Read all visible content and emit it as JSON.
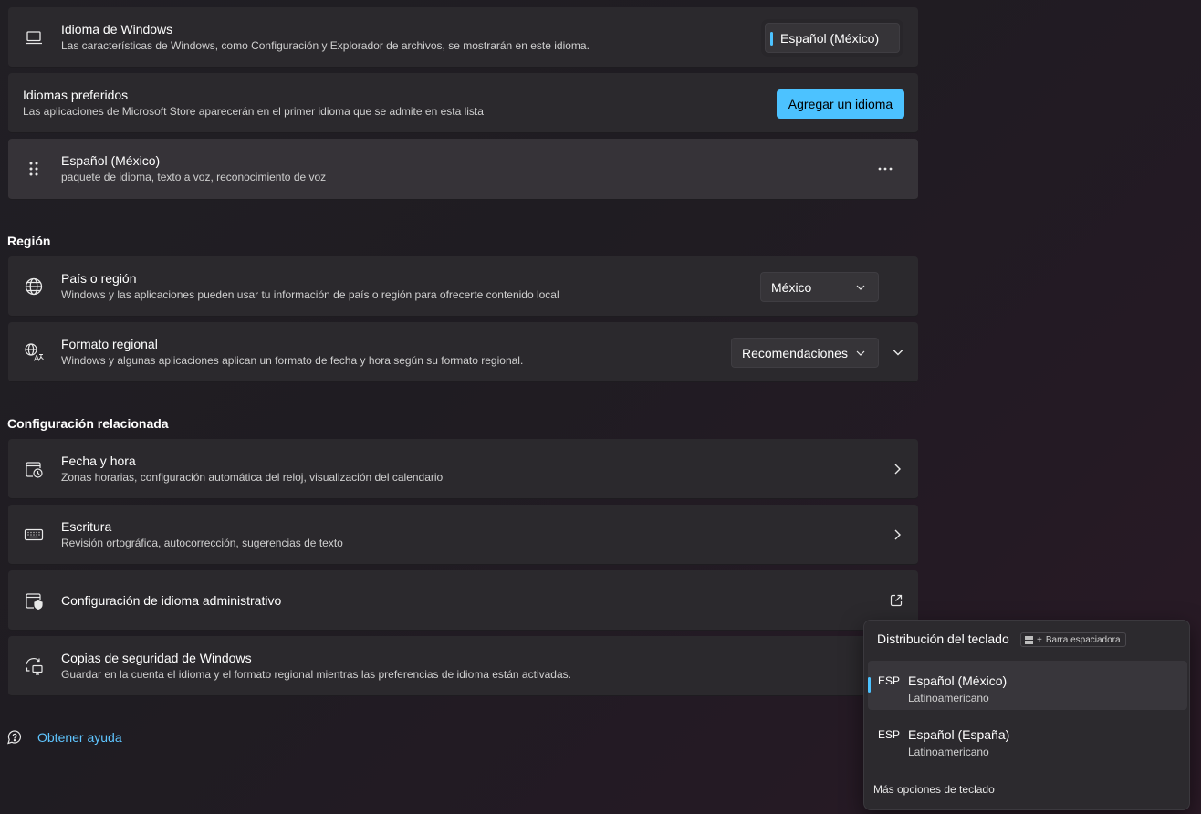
{
  "windows_language": {
    "title": "Idioma de Windows",
    "subtitle": "Las características de Windows, como Configuración y Explorador de archivos, se mostrarán en este idioma.",
    "selected": "Español (México)"
  },
  "preferred_languages": {
    "title": "Idiomas preferidos",
    "subtitle": "Las aplicaciones de Microsoft Store aparecerán en el primer idioma que se admite en esta lista",
    "add_button": "Agregar un idioma",
    "items": [
      {
        "name": "Español (México)",
        "detail": "paquete de idioma, texto a voz, reconocimiento de voz"
      }
    ]
  },
  "region": {
    "heading": "Región",
    "country": {
      "title": "País o región",
      "subtitle": "Windows y las aplicaciones pueden usar tu información de país o región para ofrecerte contenido local",
      "value": "México"
    },
    "format": {
      "title": "Formato regional",
      "subtitle": "Windows y algunas aplicaciones aplican un formato de fecha y hora según su formato regional.",
      "value": "Recomendaciones"
    }
  },
  "related": {
    "heading": "Configuración relacionada",
    "items": [
      {
        "title": "Fecha y hora",
        "subtitle": "Zonas horarias, configuración automática del reloj, visualización del calendario"
      },
      {
        "title": "Escritura",
        "subtitle": "Revisión ortográfica, autocorrección, sugerencias de texto"
      },
      {
        "title": "Configuración de idioma administrativo"
      },
      {
        "title": "Copias de seguridad de Windows",
        "subtitle": "Guardar en la cuenta el idioma y el formato regional mientras las preferencias de idioma están activadas."
      }
    ]
  },
  "help": {
    "label": "Obtener ayuda"
  },
  "keyboard_flyout": {
    "title": "Distribución del teclado",
    "shortcut_plus": "+",
    "shortcut_key": "Barra espaciadora",
    "items": [
      {
        "code": "ESP",
        "name": "Español (México)",
        "layout": "Latinoamericano"
      },
      {
        "code": "ESP",
        "name": "Español (España)",
        "layout": "Latinoamericano"
      }
    ],
    "more": "Más opciones de teclado"
  },
  "colors": {
    "accent": "#4cc2ff",
    "card": "#2b292d",
    "background": "#211f24"
  }
}
